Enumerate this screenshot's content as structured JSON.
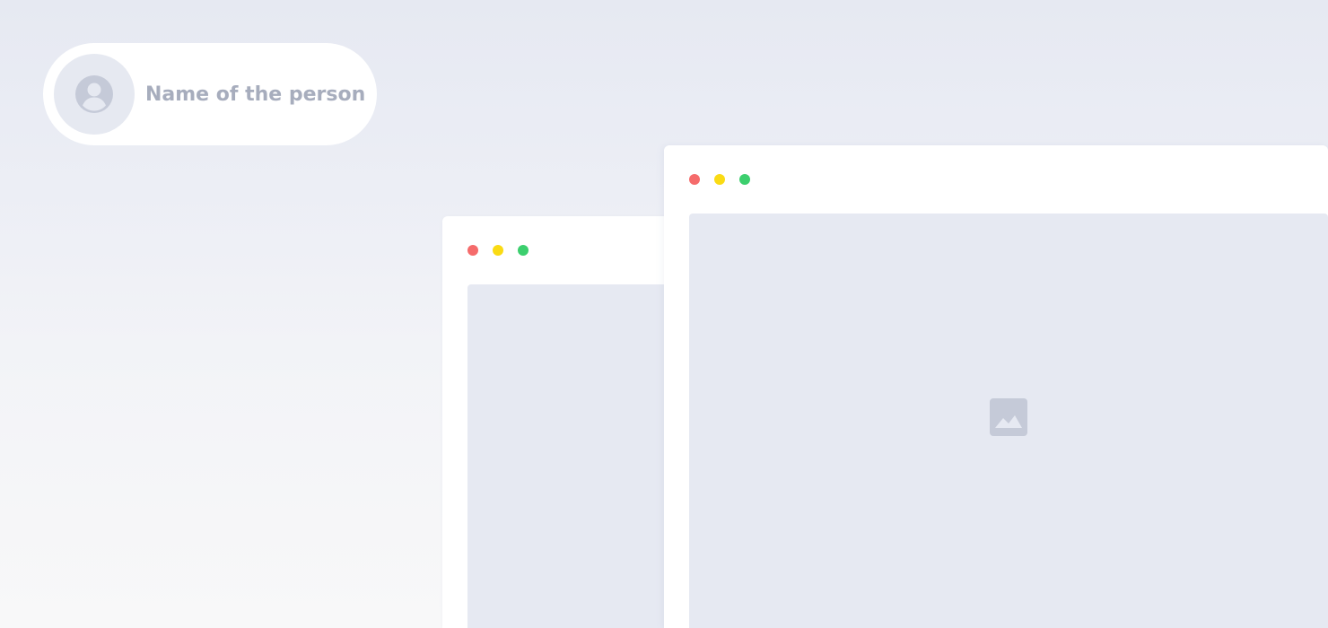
{
  "person": {
    "name": "Name of the person",
    "avatar_icon": "user-circle-icon"
  },
  "windows": [
    {
      "id": "back",
      "controls": [
        "close",
        "minimize",
        "maximize"
      ]
    },
    {
      "id": "front",
      "controls": [
        "close",
        "minimize",
        "maximize"
      ],
      "placeholder_icon": "image-icon"
    }
  ],
  "colors": {
    "close": "#f56b6b",
    "minimize": "#fadb14",
    "maximize": "#3ccf6e",
    "placeholder": "#e6e9f2",
    "icon": "#c5cad8",
    "name_text": "#a7adbd"
  }
}
